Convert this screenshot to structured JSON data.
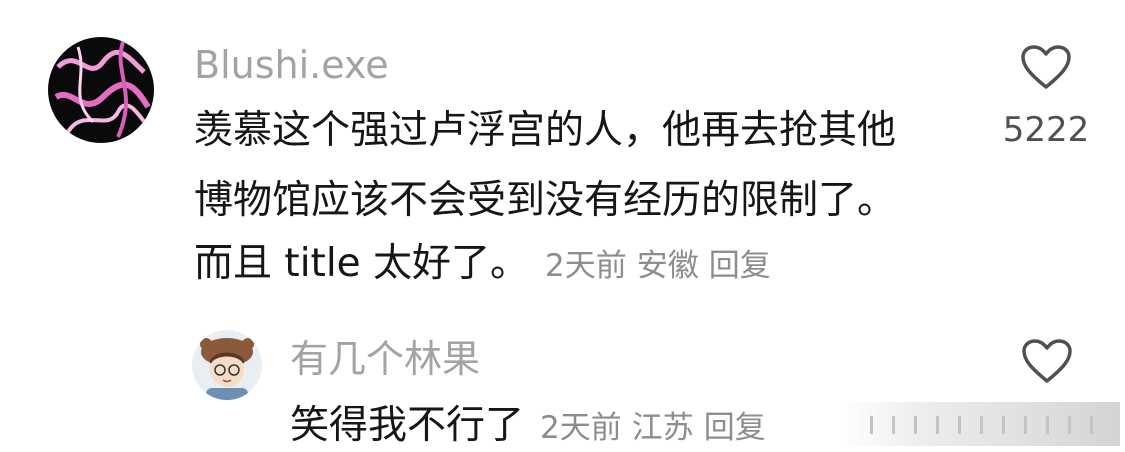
{
  "comments": [
    {
      "username": "Blushi.exe",
      "avatar_icon": "neon-avatar-icon",
      "lines": [
        "羡慕这个强过卢浮宫的人，他再去抢其他",
        "博物馆应该不会受到没有经历的限制了。",
        "而且 title 太好了。"
      ],
      "time": "2天前",
      "location": "安徽",
      "reply_label": "回复",
      "like_count": "5222",
      "like_icon": "heart-icon"
    },
    {
      "username": "有几个林果",
      "avatar_icon": "cartoon-avatar-icon",
      "lines": [
        "笑得我不行了"
      ],
      "time": "2天前",
      "location": "江苏",
      "reply_label": "回复",
      "like_count": "",
      "like_icon": "heart-icon"
    }
  ],
  "colors": {
    "text": "#161616",
    "username": "#a3a3a3",
    "meta": "#8d8d8d",
    "like_count": "#505050",
    "heart_stroke": "#505050"
  }
}
